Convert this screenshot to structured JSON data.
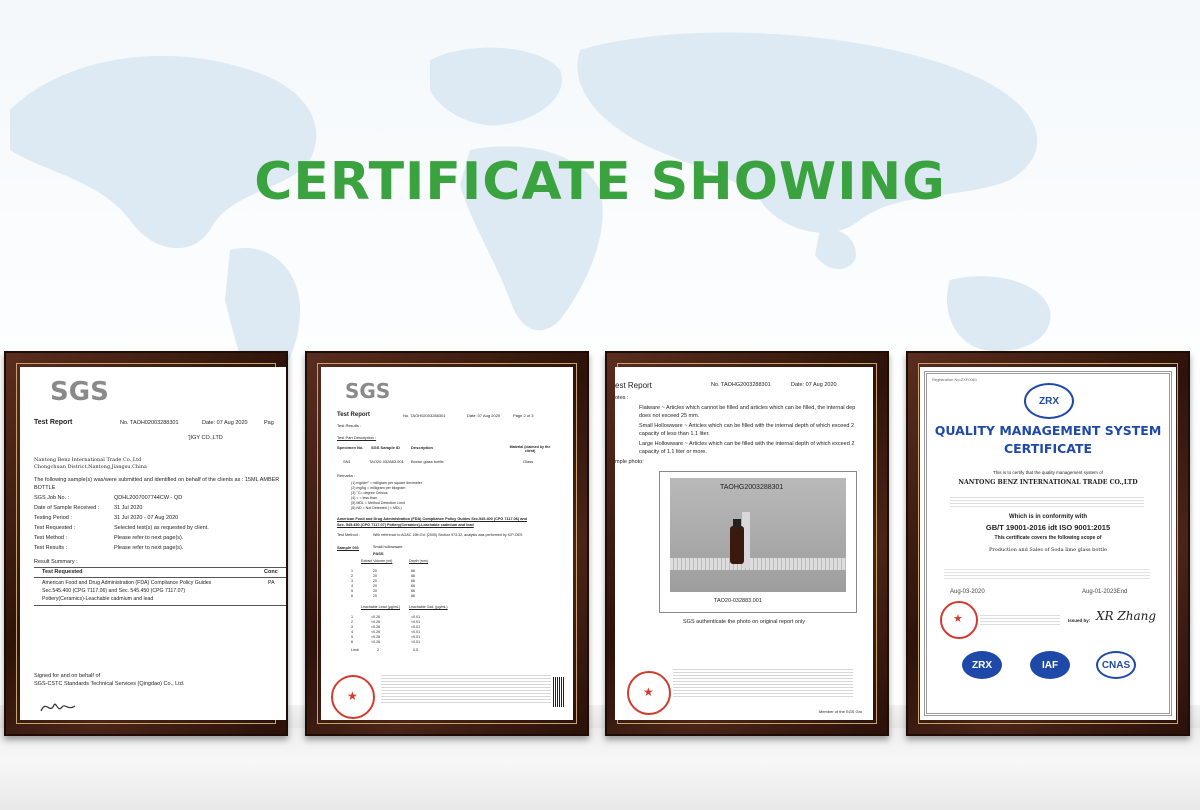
{
  "heading": "CERTIFICATE SHOWING",
  "colors": {
    "heading_green": "#3aa23e",
    "frame_wood": "#3a1a0f",
    "zrx_blue": "#1e49a8",
    "stamp_red": "#d23b2e"
  },
  "cert1": {
    "logo": "SGS",
    "title": "Test Report",
    "report_no": "No. TAOH02003288301",
    "date": "Date: 07 Aug 2020",
    "page": "Pag",
    "applicant_line": "']IGY CO.,LTD",
    "address1": "Nantong Benz International Trade Co.,Ltd",
    "address2": "Chongchuan District,Nantong,Jiangsu,China",
    "sample_line1": "The following sample(s) was/were submitted and identified on behalf of the clients as : 15ML AMBER",
    "sample_line2": "BOTTLE",
    "rows": [
      {
        "k": "SGS Job No. :",
        "v": "QDHL2007007744CW - QD"
      },
      {
        "k": "Date of Sample Received :",
        "v": "31 Jul 2020"
      },
      {
        "k": "Testing Period :",
        "v": "31 Jul 2020 - 07 Aug 2020"
      },
      {
        "k": "Test Requested :",
        "v": "Selected test(s) as requested by client."
      },
      {
        "k": "Test Method :",
        "v": "Please refer to next page(s)."
      },
      {
        "k": "Test Results :",
        "v": "Please refer to next page(s)."
      }
    ],
    "summary_label": "Result Summary :",
    "table_head1": "Test Requested",
    "table_head2": "Conc",
    "table_line1": "American Food and Drug Administration (FDA) Compliance Policy Guides",
    "table_line2": "Sec.545.400 (CPG 7117.06) and Sec. 545.450 (CPG 7117.07)",
    "table_line3": "Pottery(Ceramics)-Leachable cadmium and lead",
    "table_result": "PA",
    "signed1": "Signed for and on behalf of",
    "signed2": "SGS-CSTC Standards Technical Services (Qingdao) Co., Ltd."
  },
  "cert2": {
    "logo": "SGS",
    "title": "Test Report",
    "report_no": "No. TAOH02003288301",
    "date": "Date: 07 Aug 2020",
    "page": "Page 2 of 3",
    "results_label": "Test Results :",
    "part_label": "Test Part Description :",
    "col_specimen": "Specimen No.",
    "col_sgs": "SGS Sample ID",
    "col_desc": "Description",
    "col_material": "Material (claimed by the client)",
    "row_sn": "SN1",
    "row_id": "TAO20-032883.001",
    "row_desc": "Brown glass bottle",
    "row_mat": "Glass",
    "remarks_label": "Remarks :",
    "remarks": [
      "(1) mg/dm² = milligram per square decimeter",
      "(2) mg/kg = milligram per kilogram",
      "(3) °C= degree Celsius",
      "(4) < = less than",
      "(5) MDL = Method Detection Limit",
      "(6) ND = Not Detected ( < MDL)"
    ],
    "fda_line1": "American Food and Drug Administration (FDA) Compliance Policy Guides Sec.545.400 (CPG 7117.06) and",
    "fda_line2": "Sec. 545.450 (CPG 7117.07) Pottery(Ceramics)-Leachable cadmium and lead",
    "method_label": "Test Method :",
    "method_text": "With reference to AOAC 19th Ed. (2005) Section 973.32, analysis was performed by ICP-OES",
    "sample_label": "Sample 001",
    "sample_type": "Small hollowware",
    "pass": "PASS",
    "col_extract": "Extract Volume (ml)",
    "col_depth": "Depth (mm)",
    "col_lead": "Leachable Lead (µg/mL)",
    "col_cad": "Leachable Cad. (µg/mL)",
    "rows": [
      {
        "n": "1",
        "a": "20",
        "b": "66"
      },
      {
        "n": "2",
        "a": "20",
        "b": "66"
      },
      {
        "n": "3",
        "a": "20",
        "b": "66"
      },
      {
        "n": "4",
        "a": "20",
        "b": "66"
      },
      {
        "n": "5",
        "a": "20",
        "b": "66"
      },
      {
        "n": "6",
        "a": "20",
        "b": "66"
      }
    ],
    "leach": [
      {
        "n": "1",
        "a": "<0.26",
        "b": "<0.01"
      },
      {
        "n": "2",
        "a": "<0.26",
        "b": "<0.01"
      },
      {
        "n": "3",
        "a": "<0.26",
        "b": "<0.01"
      },
      {
        "n": "4",
        "a": "<0.26",
        "b": "<0.01"
      },
      {
        "n": "5",
        "a": "<0.26",
        "b": "<0.01"
      },
      {
        "n": "6",
        "a": "<0.26",
        "b": "<0.01"
      }
    ],
    "limit_label": "Limit",
    "limit_a": "2",
    "limit_b": "0.5"
  },
  "cert3": {
    "title": "est Report",
    "report_no": "No. TAOHG2003288301",
    "date": "Date: 07 Aug 2020",
    "notes_label": "otes :",
    "note1a": "Flatware ~ Articles which cannot be filled and articles which can be filled, the internal dep",
    "note1b": "does not exceed 25 mm.",
    "note2a": "Small Hollowware ~ Articles which can be filled with the internal depth of which exceed 2",
    "note2b": "capacity of less than 1.1 liter.",
    "note3a": "Large Hollowware ~ Articles which can be filled with the internal depth of which exceed 2",
    "note3b": "capacity of 1.1 liter or more.",
    "photo_label": "mple photo:",
    "photo_code": "TAOHG2003288301",
    "photo_caption": "TAO20-032883.001",
    "authenticate": "SGS authenticate the photo on original report only",
    "member": "Member of the SGS Gro"
  },
  "cert4": {
    "reg": "Registration No:ZXF0061",
    "logo": "ZRX",
    "title1": "QUALITY MANAGEMENT SYSTEM",
    "title2": "CERTIFICATE",
    "intro": "This is to certify that the quality management system of",
    "company": "NANTONG BENZ INTERNATIONAL TRADE CO.,LTD",
    "conformity": "Which is in conformity with",
    "standard": "GB/T 19001-2016 idt ISO 9001:2015",
    "scope_label": "This certificate covers the following scope of",
    "scope": "Production and Sales of Soda lime glass bottle",
    "date_start": "Aug-03-2020",
    "date_end": "Aug-01-2023End",
    "issued_by": "Issued by:",
    "signature": "XR Zhang",
    "seal1": "ZRX",
    "seal2": "IAF",
    "seal3": "CNAS"
  }
}
